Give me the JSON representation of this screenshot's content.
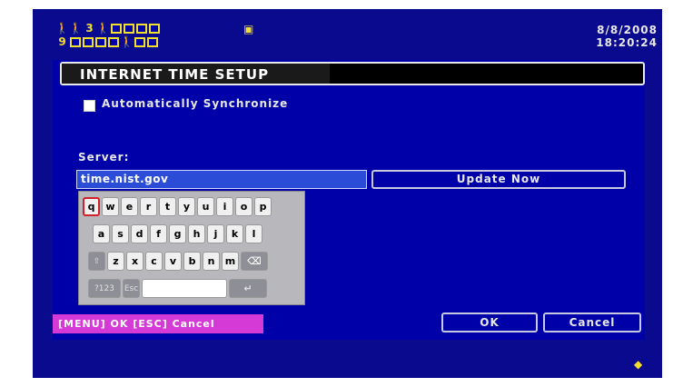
{
  "status_icons": {
    "row1": [
      "person",
      "person",
      "3",
      "person",
      "box",
      "box",
      "box",
      "box"
    ],
    "row2": [
      "9",
      "box",
      "box",
      "box",
      "box",
      "person",
      "box",
      "box"
    ],
    "hdd_icon": "hdd-icon"
  },
  "clock": {
    "date": "8/8/2008",
    "time": "18:20:24"
  },
  "page_title": "INTERNET TIME SETUP",
  "auto_sync": {
    "label": "Automatically Synchronize",
    "checked": false
  },
  "server": {
    "label": "Server:",
    "value": "time.nist.gov"
  },
  "update_button": "Update Now",
  "keyboard": {
    "row1": [
      "q",
      "w",
      "e",
      "r",
      "t",
      "y",
      "u",
      "i",
      "o",
      "p"
    ],
    "row2": [
      "a",
      "s",
      "d",
      "f",
      "g",
      "h",
      "j",
      "k",
      "l"
    ],
    "row3_shift": "⇧",
    "row3": [
      "z",
      "x",
      "c",
      "v",
      "b",
      "n",
      "m"
    ],
    "row3_backspace": "⌫",
    "row4_mode": "?123",
    "row4_esc": "Esc",
    "row4_enter": "↵",
    "selected_key": "q"
  },
  "menu_hint": "[MENU] OK  [ESC] Cancel",
  "ok_button": "OK",
  "cancel_button": "Cancel",
  "colors": {
    "background": "#0000a8",
    "accent": "#d63ad6",
    "input": "#2b4cd6",
    "icon": "#f1df2c"
  }
}
